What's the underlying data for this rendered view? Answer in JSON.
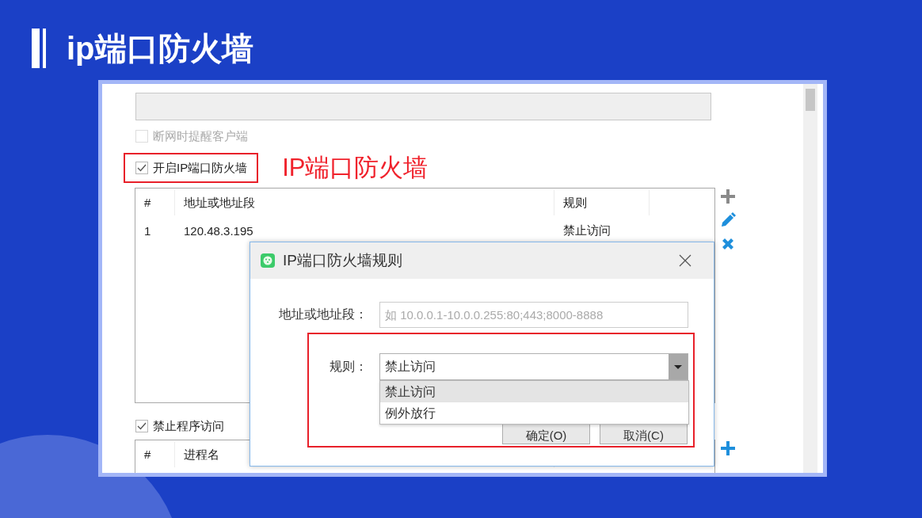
{
  "slide": {
    "title": "ip端口防火墙"
  },
  "annotation": {
    "text": "IP端口防火墙"
  },
  "checkboxes": [
    {
      "label": "断网时提醒客户端",
      "checked": false,
      "disabled": true,
      "highlighted": false
    },
    {
      "label": "开启IP端口防火墙",
      "checked": true,
      "disabled": false,
      "highlighted": true
    }
  ],
  "ip_table": {
    "columns": [
      "#",
      "地址或地址段",
      "规则"
    ],
    "rows": [
      [
        "1",
        "120.48.3.195",
        "禁止访问"
      ]
    ]
  },
  "ip_table_tools": [
    {
      "kind": "add",
      "disabled": true
    },
    {
      "kind": "edit",
      "disabled": false
    },
    {
      "kind": "delete",
      "disabled": false
    }
  ],
  "program_checkbox": {
    "label": "禁止程序访问",
    "checked": true
  },
  "program_table": {
    "columns": [
      "#",
      "进程名"
    ]
  },
  "program_tools": [
    {
      "kind": "add",
      "disabled": false
    }
  ],
  "dialog": {
    "title": "IP端口防火墙规则",
    "address_label": "地址或地址段：",
    "address_placeholder": "如 10.0.0.1-10.0.0.255:80;443;8000-8888",
    "rule_label": "规则：",
    "rule_value": "禁止访问",
    "rule_expanded": true,
    "rule_options": [
      {
        "label": "禁止访问",
        "selected": true
      },
      {
        "label": "例外放行",
        "selected": false
      }
    ],
    "buttons": [
      "确定(O)",
      "取消(C)"
    ]
  }
}
